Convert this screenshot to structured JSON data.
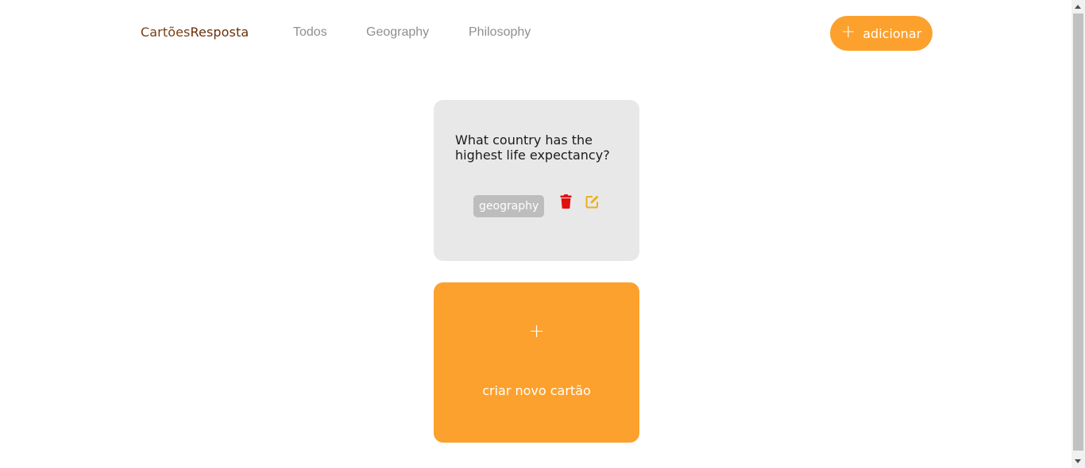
{
  "header": {
    "brand_part1": "Cartões",
    "brand_part2": "Resposta",
    "nav": [
      {
        "label": "Todos"
      },
      {
        "label": "Geography"
      },
      {
        "label": "Philosophy"
      }
    ],
    "add_button": {
      "icon": "+",
      "label": "adicionar"
    }
  },
  "cards": [
    {
      "question": "What country has the highest life expectancy?",
      "tag": "geography",
      "delete_icon": "trash-icon",
      "edit_icon": "edit-icon"
    }
  ],
  "new_card": {
    "icon": "+",
    "label": "criar novo cartão"
  },
  "colors": {
    "accent": "#fca12d",
    "card_bg": "#e8e8e8",
    "tag_bg": "#bdbdbd",
    "delete": "#e01010",
    "edit": "#e8b21c",
    "brand": "#7a3d12"
  }
}
